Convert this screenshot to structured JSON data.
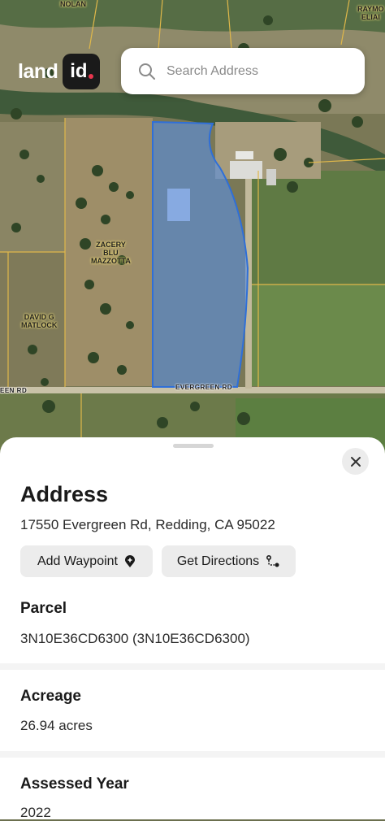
{
  "app": {
    "logo_word": "land",
    "logo_badge": "id"
  },
  "search": {
    "placeholder": "Search Address"
  },
  "map": {
    "labels": {
      "nolan": "NOLAN",
      "raymond": "RAYMO\nELIAI",
      "zacery": "ZACERY\nBLU\nMAZZOTTA",
      "david": "DAVID G\nMATLOCK"
    },
    "roads": {
      "left": "EEN RD",
      "main": "EVERGREEN RD"
    }
  },
  "sheet": {
    "address_title": "Address",
    "address_value": "17550 Evergreen Rd, Redding, CA 95022",
    "add_waypoint_label": "Add Waypoint",
    "get_directions_label": "Get Directions",
    "parcel_title": "Parcel",
    "parcel_value": "3N10E36CD6300 (3N10E36CD6300)",
    "acreage_title": "Acreage",
    "acreage_value": "26.94 acres",
    "assessed_year_title": "Assessed Year",
    "assessed_year_value": "2022"
  },
  "colors": {
    "parcel_fill": "#5b8fe0",
    "parcel_stroke": "#2f6fd8",
    "lot_line": "#e0b84a",
    "brand_dot": "#e8364e"
  }
}
